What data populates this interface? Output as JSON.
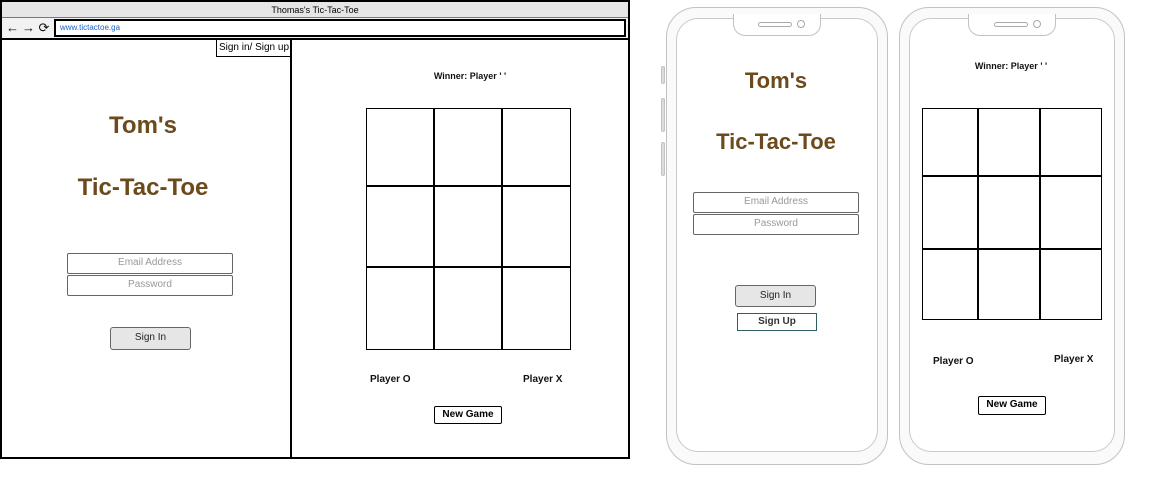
{
  "browser": {
    "title": "Thomas's Tic-Tac-Toe",
    "url": "www.tictactoe.ga",
    "auth_link": "Sign in/ Sign up"
  },
  "brand": {
    "line1": "Tom's",
    "line2": "Tic-Tac-Toe",
    "color": "#6b4a1c"
  },
  "form": {
    "email_placeholder": "Email Address",
    "password_placeholder": "Password",
    "signin_label": "Sign In",
    "signup_label": "Sign Up"
  },
  "game": {
    "winner_text": "Winner: Player ' '",
    "player_o": "Player O",
    "player_x": "Player X",
    "new_game_label": "New Game"
  },
  "icons": {
    "back": "arrow-left-icon",
    "forward": "arrow-right-icon",
    "reload": "reload-icon"
  }
}
